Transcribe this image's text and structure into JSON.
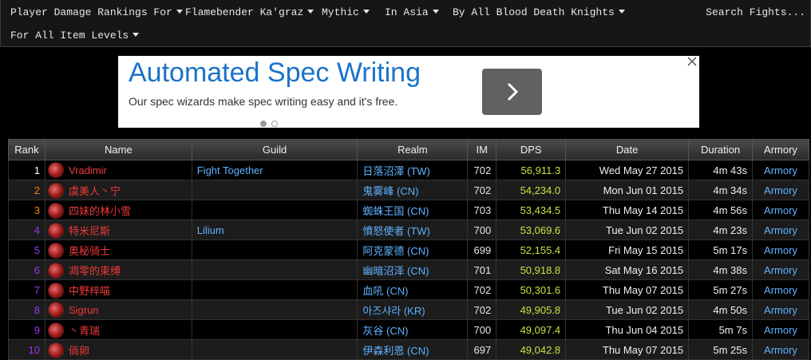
{
  "nav": {
    "row1": [
      {
        "label": "Player Damage Rankings For"
      },
      {
        "label": "Flamebender Ka'graz"
      },
      {
        "label": "Mythic"
      },
      {
        "label": "In Asia"
      },
      {
        "label": "By All Blood Death Knights"
      }
    ],
    "row2": [
      {
        "label": "For All Item Levels"
      }
    ],
    "search_label": "Search Fights..."
  },
  "ad": {
    "headline": "Automated Spec Writing",
    "subtext": "Our spec wizards make spec writing easy and it's free."
  },
  "colors": {
    "rank_purple": "#a335ee",
    "rank_orange": "#ff8000",
    "name_red": "#ee3838",
    "link_blue": "#5fb2ff",
    "dps_green": "#c8e040"
  },
  "table": {
    "headers": [
      "Rank",
      "Name",
      "Guild",
      "Realm",
      "IM",
      "DPS",
      "Date",
      "Duration",
      "Armory"
    ],
    "rows": [
      {
        "rank": "1",
        "rank_color": "#ffffff",
        "name": "Vradimir",
        "guild": "Fight Together",
        "realm": "日落沼澤 (TW)",
        "im": "702",
        "dps": "56,911.3",
        "date": "Wed May 27 2015",
        "duration": "4m 43s",
        "armory": "Armory"
      },
      {
        "rank": "2",
        "rank_color": "#ff8000",
        "name": "虞美人丶宁",
        "guild": "",
        "realm": "鬼雾峰 (CN)",
        "im": "702",
        "dps": "54,234.0",
        "date": "Mon Jun 01 2015",
        "duration": "4m 34s",
        "armory": "Armory"
      },
      {
        "rank": "3",
        "rank_color": "#ff8000",
        "name": "四妹的林小雪",
        "guild": "",
        "realm": "蜘蛛王国 (CN)",
        "im": "703",
        "dps": "53,434.5",
        "date": "Thu May 14 2015",
        "duration": "4m 56s",
        "armory": "Armory"
      },
      {
        "rank": "4",
        "rank_color": "#a335ee",
        "name": "特米尼斯",
        "guild": "Lilium",
        "realm": "憤怒使者 (TW)",
        "im": "700",
        "dps": "53,069.6",
        "date": "Tue Jun 02 2015",
        "duration": "4m 23s",
        "armory": "Armory"
      },
      {
        "rank": "5",
        "rank_color": "#a335ee",
        "name": "奥秘骑士",
        "guild": "",
        "realm": "阿克蒙德 (CN)",
        "im": "699",
        "dps": "52,155.4",
        "date": "Fri May 15 2015",
        "duration": "5m 17s",
        "armory": "Armory"
      },
      {
        "rank": "6",
        "rank_color": "#a335ee",
        "name": "凋零的束缚",
        "guild": "",
        "realm": "幽暗沼泽 (CN)",
        "im": "701",
        "dps": "50,918.8",
        "date": "Sat May 16 2015",
        "duration": "4m 38s",
        "armory": "Armory"
      },
      {
        "rank": "7",
        "rank_color": "#a335ee",
        "name": "中野梓喵",
        "guild": "",
        "realm": "血吼 (CN)",
        "im": "702",
        "dps": "50,301.6",
        "date": "Thu May 07 2015",
        "duration": "5m 27s",
        "armory": "Armory"
      },
      {
        "rank": "8",
        "rank_color": "#a335ee",
        "name": "Sigrun",
        "guild": "",
        "realm": "아즈샤라 (KR)",
        "im": "702",
        "dps": "49,905.8",
        "date": "Tue Jun 02 2015",
        "duration": "4m 50s",
        "armory": "Armory"
      },
      {
        "rank": "9",
        "rank_color": "#a335ee",
        "name": "丶青瑞",
        "guild": "",
        "realm": "灰谷 (CN)",
        "im": "700",
        "dps": "49,097.4",
        "date": "Thu Jun 04 2015",
        "duration": "5m 7s",
        "armory": "Armory"
      },
      {
        "rank": "10",
        "rank_color": "#a335ee",
        "name": "倘卵",
        "guild": "",
        "realm": "伊森利恩 (CN)",
        "im": "697",
        "dps": "49,042.8",
        "date": "Thu May 07 2015",
        "duration": "5m 25s",
        "armory": "Armory"
      }
    ]
  }
}
